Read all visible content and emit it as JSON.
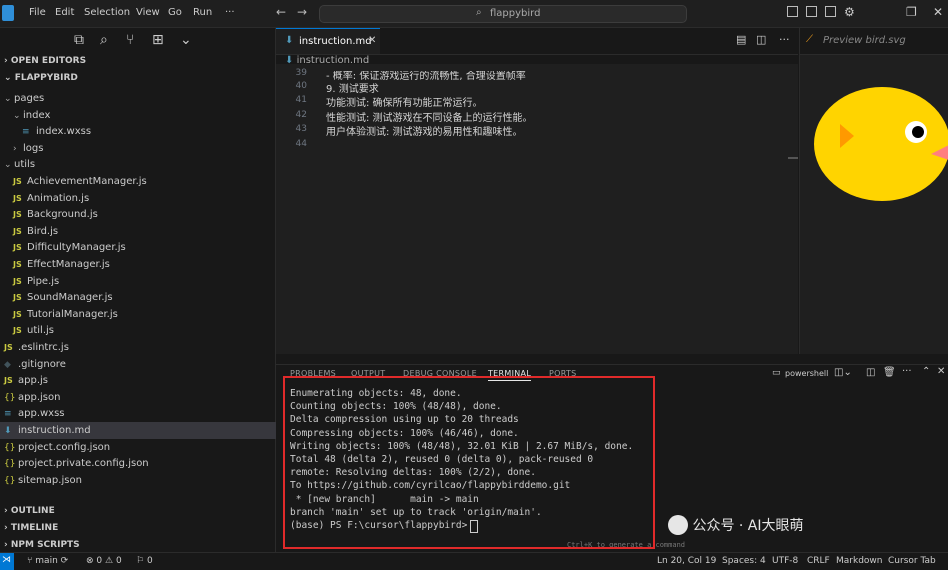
{
  "titlebar": {
    "menu": [
      "File",
      "Edit",
      "Selection",
      "View",
      "Go",
      "Run",
      "···"
    ],
    "search_text": "flappybird"
  },
  "sidebar": {
    "open_editors": "OPEN EDITORS",
    "project": "FLAPPYBIRD",
    "tree": [
      {
        "label": "pages",
        "kind": "folder-open",
        "indent": 1
      },
      {
        "label": "index",
        "kind": "folder-open",
        "indent": 2
      },
      {
        "label": "index.wxss",
        "kind": "wxss",
        "indent": 3
      },
      {
        "label": "logs",
        "kind": "folder",
        "indent": 2
      },
      {
        "label": "utils",
        "kind": "folder-open",
        "indent": 1
      },
      {
        "label": "AchievementManager.js",
        "kind": "js",
        "indent": 2
      },
      {
        "label": "Animation.js",
        "kind": "js",
        "indent": 2
      },
      {
        "label": "Background.js",
        "kind": "js",
        "indent": 2
      },
      {
        "label": "Bird.js",
        "kind": "js",
        "indent": 2
      },
      {
        "label": "DifficultyManager.js",
        "kind": "js",
        "indent": 2
      },
      {
        "label": "EffectManager.js",
        "kind": "js",
        "indent": 2
      },
      {
        "label": "Pipe.js",
        "kind": "js",
        "indent": 2
      },
      {
        "label": "SoundManager.js",
        "kind": "js",
        "indent": 2
      },
      {
        "label": "TutorialManager.js",
        "kind": "js",
        "indent": 2
      },
      {
        "label": "util.js",
        "kind": "js",
        "indent": 2
      },
      {
        "label": ".eslintrc.js",
        "kind": "js",
        "indent": 1
      },
      {
        "label": ".gitignore",
        "kind": "git",
        "indent": 1
      },
      {
        "label": "app.js",
        "kind": "js",
        "indent": 1
      },
      {
        "label": "app.json",
        "kind": "json",
        "indent": 1
      },
      {
        "label": "app.wxss",
        "kind": "wxss",
        "indent": 1
      },
      {
        "label": "instruction.md",
        "kind": "md",
        "indent": 1,
        "selected": true
      },
      {
        "label": "project.config.json",
        "kind": "json",
        "indent": 1
      },
      {
        "label": "project.private.config.json",
        "kind": "json",
        "indent": 1
      },
      {
        "label": "sitemap.json",
        "kind": "json",
        "indent": 1
      }
    ],
    "outline": "OUTLINE",
    "timeline": "TIMELINE",
    "npm_scripts": "NPM SCRIPTS"
  },
  "editor": {
    "tab_label": "instruction.md",
    "breadcrumb": "instruction.md",
    "lines": [
      {
        "n": "39",
        "text": "- 概率: 保证游戏运行的流畅性, 合理设置帧率"
      },
      {
        "n": "40",
        "text": "9. 测试要求"
      },
      {
        "n": "41",
        "text": "功能测试: 确保所有功能正常运行。"
      },
      {
        "n": "42",
        "text": "性能测试: 测试游戏在不同设备上的运行性能。"
      },
      {
        "n": "43",
        "text": "用户体验测试: 测试游戏的易用性和趣味性。"
      },
      {
        "n": "44",
        "text": ""
      }
    ]
  },
  "preview": {
    "tab_label": "Preview bird.svg",
    "colors": {
      "body": "#ffd400",
      "wing": "#ff9900",
      "beak": "#ff7f7f"
    }
  },
  "panel": {
    "tabs": [
      "PROBLEMS",
      "OUTPUT",
      "DEBUG CONSOLE",
      "TERMINAL",
      "PORTS"
    ],
    "active_tab": "TERMINAL",
    "shell": "powershell",
    "terminal_lines": [
      "Enumerating objects: 48, done.",
      "Counting objects: 100% (48/48), done.",
      "Delta compression using up to 20 threads",
      "Compressing objects: 100% (46/46), done.",
      "Writing objects: 100% (48/48), 32.01 KiB | 2.67 MiB/s, done.",
      "Total 48 (delta 2), reused 0 (delta 0), pack-reused 0",
      "remote: Resolving deltas: 100% (2/2), done.",
      "To https://github.com/cyrilcao/flappybirddemo.git",
      " * [new branch]      main -> main",
      "branch 'main' set up to track 'origin/main'.",
      "(base) PS F:\\cursor\\flappybird> "
    ],
    "hint": "Ctrl+K to generate a command",
    "watermark": "公众号 · AI大眼萌"
  },
  "status": {
    "branch": "main",
    "errors": "0",
    "warnings": "0",
    "ports": "0",
    "position": "Ln 20, Col 19",
    "spaces": "Spaces: 4",
    "encoding": "UTF-8",
    "eol": "CRLF",
    "language": "Markdown",
    "extension": "Cursor Tab"
  }
}
